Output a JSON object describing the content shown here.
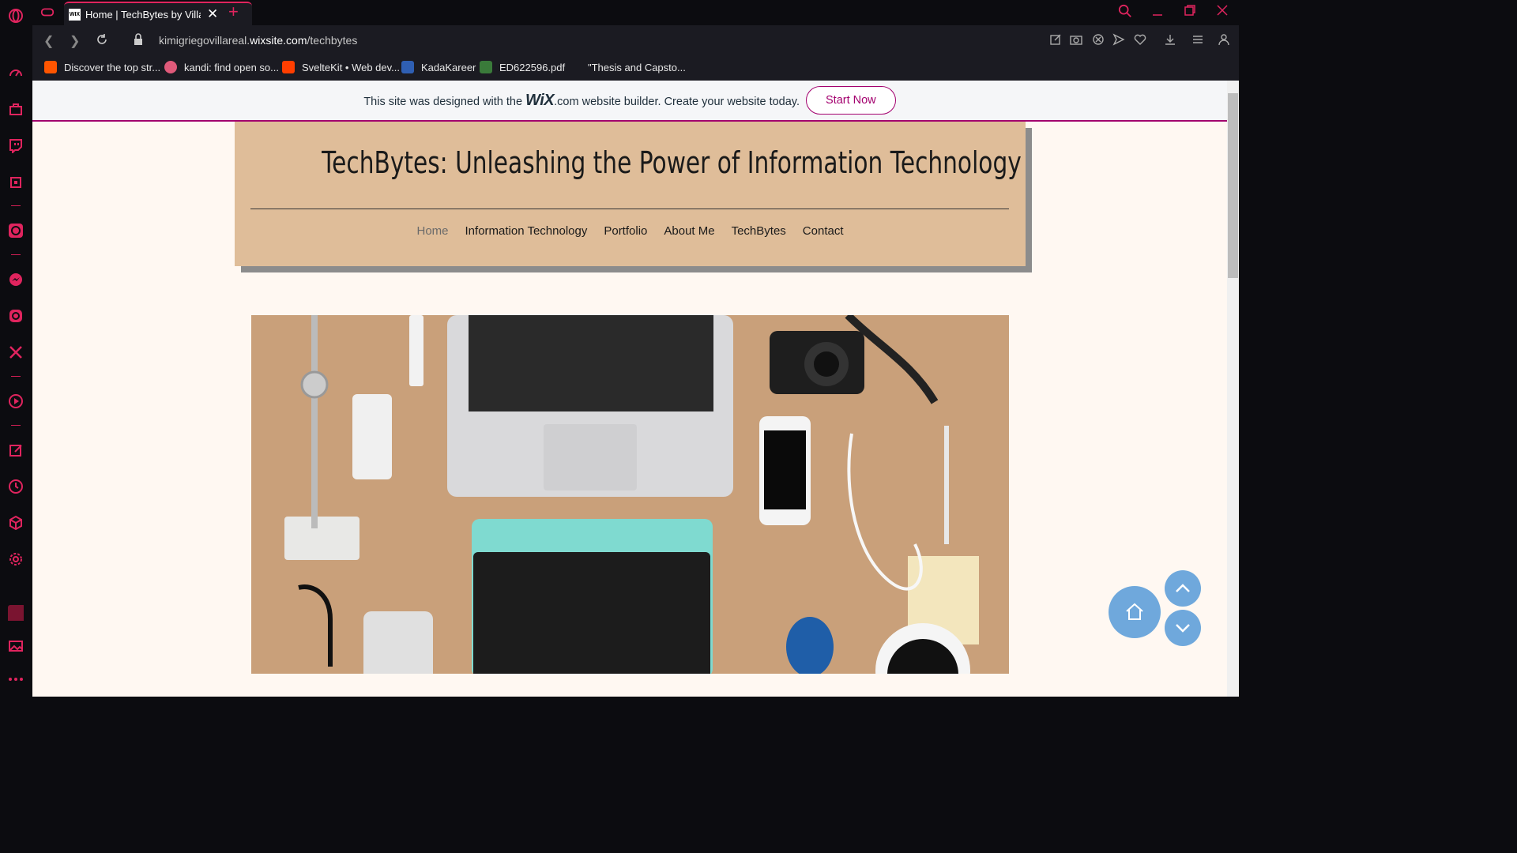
{
  "browser": {
    "tab_title": "Home | TechBytes by Villarreal",
    "favicon_text": "WIX",
    "new_tab": "+",
    "url_prefix": "kimigriegovillareal.",
    "url_domain": "wixsite.com",
    "url_path": "/techbytes",
    "bookmarks": [
      {
        "label": "Discover the top str...",
        "color": "#ff5500"
      },
      {
        "label": "kandi: find open so...",
        "color": "#e05a7a"
      },
      {
        "label": "SvelteKit • Web dev...",
        "color": "#ff3e00"
      },
      {
        "label": "KadaKareer",
        "color": "#2f5fb3"
      },
      {
        "label": "ED622596.pdf",
        "color": "#3a7a3a"
      },
      {
        "label": "\"Thesis and Capsto...",
        "color": "#1b1b22"
      }
    ]
  },
  "wix_banner": {
    "text_before": "This site was designed with the ",
    "logo": "WiX",
    "logo_suffix": ".com",
    "text_after": " website builder. Create your website today.",
    "cta": "Start Now"
  },
  "site": {
    "title": "TechBytes: Unleashing the Power of Information Technology",
    "nav": [
      "Home",
      "Information Technology",
      "Portfolio",
      "About Me",
      "TechBytes",
      "Contact"
    ]
  },
  "colors": {
    "accent": "#e0245e",
    "header_bg": "#dfbd99",
    "page_bg": "#fff8f2",
    "wix_accent": "#a3006e",
    "fab": "#6fa8dc"
  }
}
